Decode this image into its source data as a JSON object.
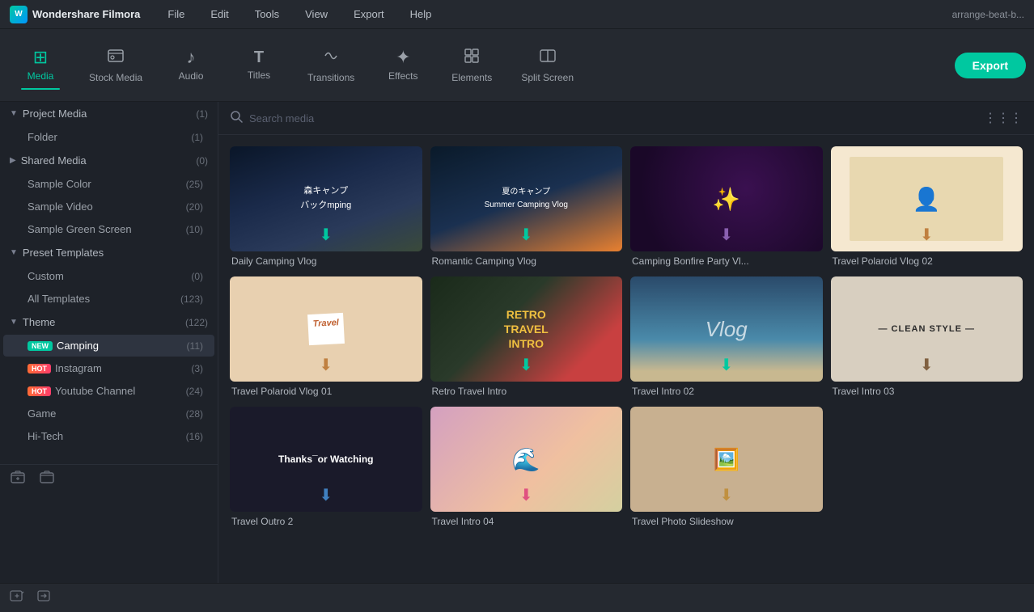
{
  "app": {
    "name": "Wondershare Filmora",
    "user": "arrange-beat-b..."
  },
  "menu": {
    "items": [
      "File",
      "Edit",
      "Tools",
      "View",
      "Export",
      "Help"
    ]
  },
  "toolbar": {
    "export_label": "Export",
    "buttons": [
      {
        "id": "media",
        "label": "Media",
        "icon": "⊞",
        "active": true
      },
      {
        "id": "stock-media",
        "label": "Stock Media",
        "icon": "🎬",
        "active": false
      },
      {
        "id": "audio",
        "label": "Audio",
        "icon": "♪",
        "active": false
      },
      {
        "id": "titles",
        "label": "Titles",
        "icon": "T",
        "active": false
      },
      {
        "id": "transitions",
        "label": "Transitions",
        "icon": "⟲",
        "active": false
      },
      {
        "id": "effects",
        "label": "Effects",
        "icon": "✦",
        "active": false
      },
      {
        "id": "elements",
        "label": "Elements",
        "icon": "⧫",
        "active": false
      },
      {
        "id": "split-screen",
        "label": "Split Screen",
        "icon": "⧉",
        "active": false
      }
    ]
  },
  "search": {
    "placeholder": "Search media"
  },
  "sidebar": {
    "project_media": {
      "label": "Project Media",
      "count": "(1)"
    },
    "folder": {
      "label": "Folder",
      "count": "(1)"
    },
    "shared_media": {
      "label": "Shared Media",
      "count": "(0)"
    },
    "sample_color": {
      "label": "Sample Color",
      "count": "(25)"
    },
    "sample_video": {
      "label": "Sample Video",
      "count": "(20)"
    },
    "sample_green": {
      "label": "Sample Green Screen",
      "count": "(10)"
    },
    "preset_templates": {
      "label": "Preset Templates"
    },
    "custom": {
      "label": "Custom",
      "count": "(0)"
    },
    "all_templates": {
      "label": "All Templates",
      "count": "(123)"
    },
    "theme": {
      "label": "Theme",
      "count": "(122)"
    },
    "camping": {
      "label": "Camping",
      "count": "(11)",
      "badge": "New"
    },
    "instagram": {
      "label": "Instagram",
      "count": "(3)",
      "badge": "HOT"
    },
    "youtube": {
      "label": "Youtube Channel",
      "count": "(24)",
      "badge": "HOT"
    },
    "game": {
      "label": "Game",
      "count": "(28)"
    },
    "hitech": {
      "label": "Hi-Tech",
      "count": "(16)"
    }
  },
  "grid": {
    "items": [
      {
        "id": "daily-camping-vlog",
        "title": "Daily Camping Vlog",
        "thumb_type": "daily-camping"
      },
      {
        "id": "romantic-camping-vlog",
        "title": "Romantic Camping Vlog",
        "thumb_type": "romantic"
      },
      {
        "id": "camping-bonfire",
        "title": "Camping Bonfire Party Vl...",
        "thumb_type": "bonfire"
      },
      {
        "id": "travel-polaroid2",
        "title": "Travel Polaroid Vlog 02",
        "thumb_type": "travel-polaroid2"
      },
      {
        "id": "travel-polaroid1",
        "title": "Travel Polaroid Vlog 01",
        "thumb_type": "travel-polaroid1"
      },
      {
        "id": "retro-travel-intro",
        "title": "Retro Travel Intro",
        "thumb_type": "retro"
      },
      {
        "id": "travel-intro2",
        "title": "Travel Intro 02",
        "thumb_type": "travel-intro2"
      },
      {
        "id": "travel-intro3",
        "title": "Travel Intro 03",
        "thumb_type": "clean-style"
      },
      {
        "id": "travel-outro2",
        "title": "Travel Outro 2",
        "thumb_type": "travel-outro"
      },
      {
        "id": "travel-intro4",
        "title": "Travel Intro 04",
        "thumb_type": "travel-intro4"
      },
      {
        "id": "travel-photo-slideshow",
        "title": "Travel Photo Slideshow",
        "thumb_type": "travel-photo"
      }
    ]
  }
}
